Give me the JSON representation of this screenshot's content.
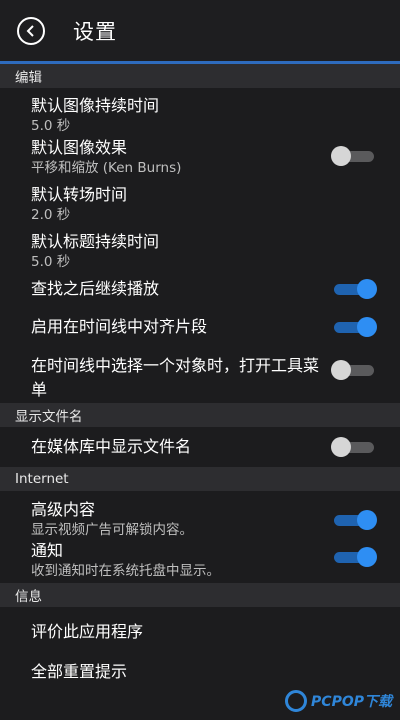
{
  "header": {
    "title": "设置"
  },
  "sections": {
    "edit": "编辑",
    "filename": "显示文件名",
    "internet": "Internet",
    "info": "信息"
  },
  "rows": {
    "img_duration": {
      "label": "默认图像持续时间",
      "value": "5.0  秒"
    },
    "img_effect": {
      "label": "默认图像效果",
      "value": "平移和缩放 (Ken Burns)",
      "toggle": "off"
    },
    "transition": {
      "label": "默认转场时间",
      "value": "2.0  秒"
    },
    "title_duration": {
      "label": "默认标题持续时间",
      "value": "5.0  秒"
    },
    "continue_play": {
      "label": "查找之后继续播放",
      "toggle": "on"
    },
    "snap": {
      "label": "启用在时间线中对齐片段",
      "toggle": "on"
    },
    "toolbar_menu": {
      "label": "在时间线中选择一个对象时，打开工具菜单",
      "toggle": "off"
    },
    "show_filename": {
      "label": "在媒体库中显示文件名",
      "toggle": "off"
    },
    "premium": {
      "label": "高级内容",
      "sub": "显示视频广告可解锁内容。",
      "toggle": "on"
    },
    "notify": {
      "label": "通知",
      "sub": "收到通知时在系统托盘中显示。",
      "toggle": "on"
    },
    "rate": {
      "label": "评价此应用程序"
    },
    "reset": {
      "label": "全部重置提示"
    }
  },
  "watermark": {
    "text": "PCPOP下载"
  },
  "colors": {
    "accent": "#2e8ef3",
    "header_line": "#2e6bbd",
    "bg": "#1c1c1e",
    "section_bg": "#2d2d30"
  },
  "icons": {
    "back": "chevron-left-circle-icon"
  }
}
